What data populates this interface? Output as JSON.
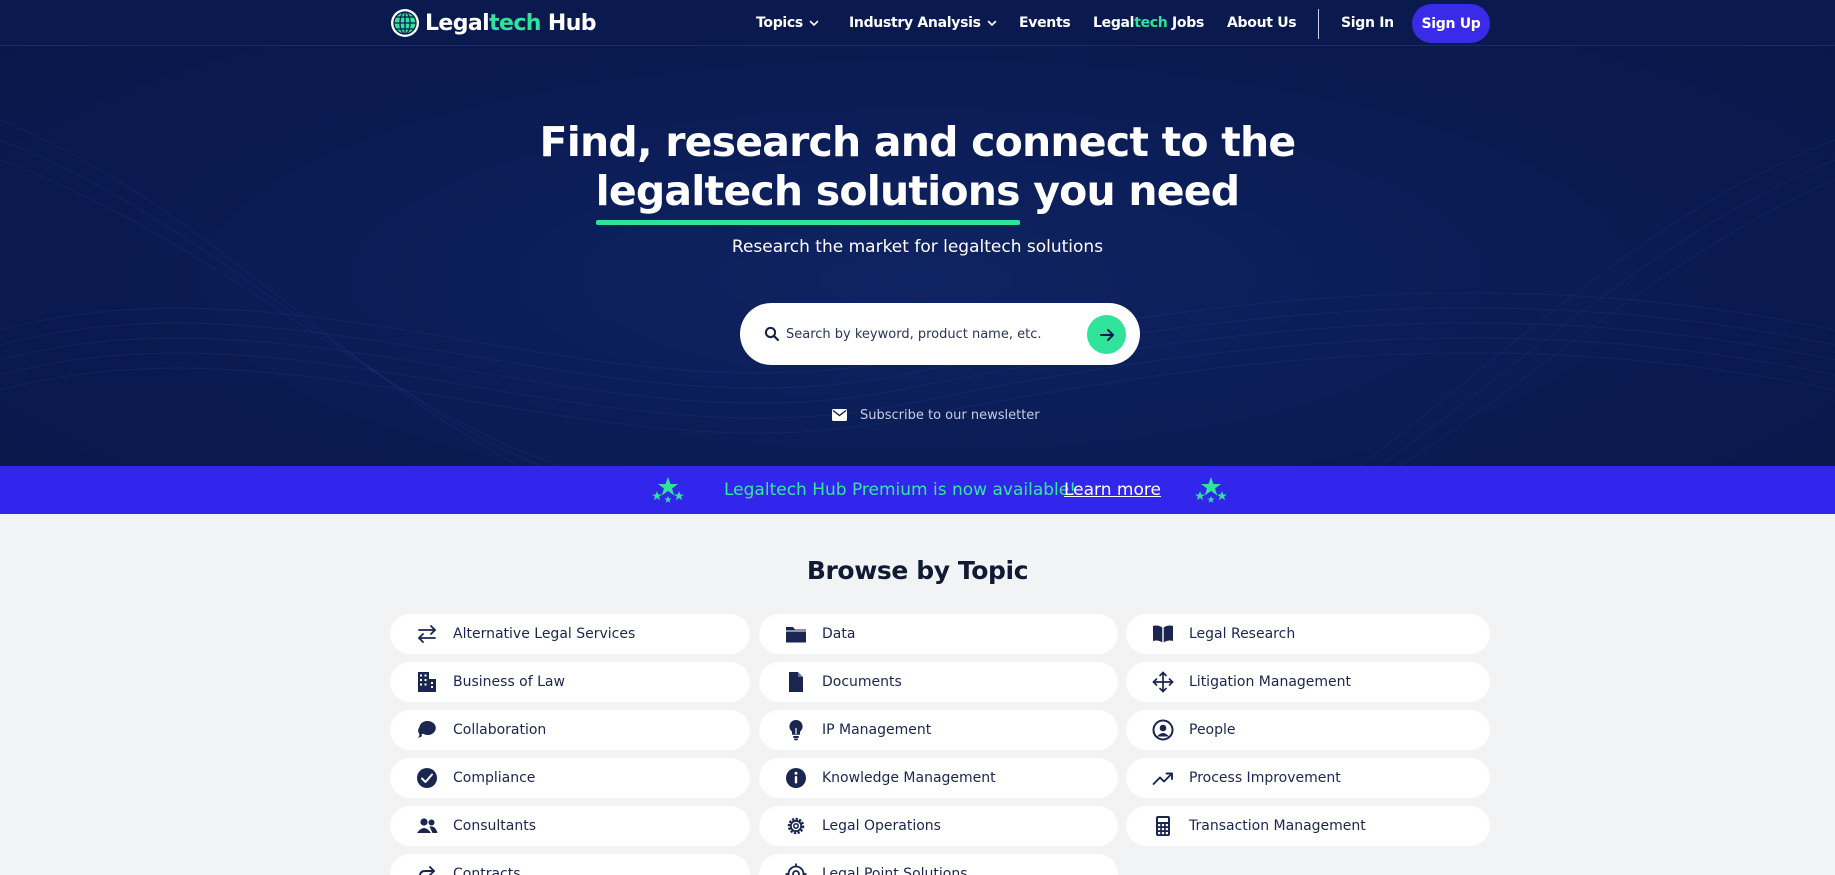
{
  "brand": {
    "name_part1": "Legal",
    "name_part2": "tech",
    "name_part3": " Hub",
    "accent_color": "#2fe39a",
    "primary_color": "#3a2be8",
    "navy_color": "#0a1a4f"
  },
  "nav": {
    "topics": "Topics",
    "industry_analysis": "Industry Analysis",
    "events": "Events",
    "jobs_part1": "Legal",
    "jobs_part2": "tech",
    "jobs_part3": " Jobs",
    "about": "About Us",
    "sign_in": "Sign In",
    "sign_up": "Sign Up"
  },
  "hero": {
    "headline_line1": "Find, research and connect to the",
    "headline_highlight": "legaltech solutions",
    "headline_rest": " you need",
    "subheadline": "Research the market for legaltech solutions",
    "search_placeholder": "Search by keyword, product name, etc.",
    "newsletter_label": "Subscribe to our newsletter"
  },
  "banner": {
    "message": "Legaltech Hub Premium is now available!",
    "link": "Learn more"
  },
  "browse": {
    "title": "Browse by Topic",
    "topics": [
      {
        "label": "Alternative Legal Services",
        "icon": "arrows-exchange-icon"
      },
      {
        "label": "Data",
        "icon": "folder-icon"
      },
      {
        "label": "Legal Research",
        "icon": "open-book-icon"
      },
      {
        "label": "Business of Law",
        "icon": "building-icon"
      },
      {
        "label": "Documents",
        "icon": "document-icon"
      },
      {
        "label": "Litigation Management",
        "icon": "move-arrows-icon"
      },
      {
        "label": "Collaboration",
        "icon": "chat-bubbles-icon"
      },
      {
        "label": "IP Management",
        "icon": "lightbulb-icon"
      },
      {
        "label": "People",
        "icon": "user-circle-icon"
      },
      {
        "label": "Compliance",
        "icon": "check-circle-icon"
      },
      {
        "label": "Knowledge Management",
        "icon": "info-circle-icon"
      },
      {
        "label": "Process Improvement",
        "icon": "trending-up-icon"
      },
      {
        "label": "Consultants",
        "icon": "users-icon"
      },
      {
        "label": "Legal Operations",
        "icon": "cog-icon"
      },
      {
        "label": "Transaction Management",
        "icon": "calculator-icon"
      },
      {
        "label": "Contracts",
        "icon": "share-arrow-icon"
      },
      {
        "label": "Legal Point Solutions",
        "icon": "target-icon"
      }
    ]
  }
}
